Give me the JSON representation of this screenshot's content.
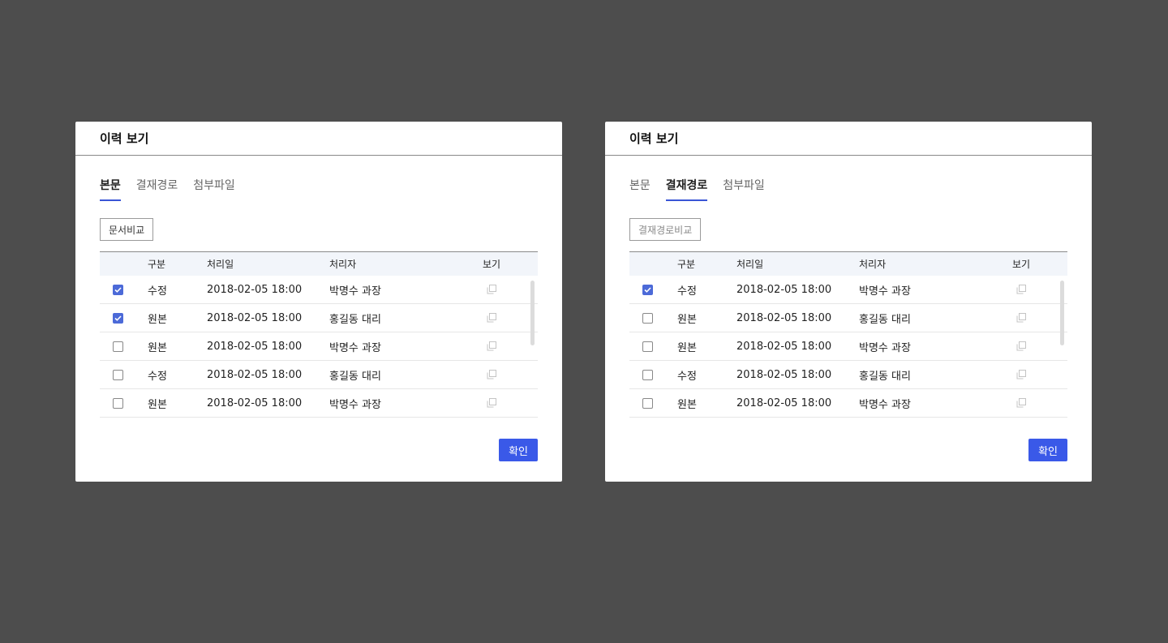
{
  "left": {
    "title": "이력 보기",
    "tabs": [
      "본문",
      "결재경로",
      "첨부파일"
    ],
    "active_tab": 0,
    "compare_label": "문서비교",
    "headers": {
      "type": "구분",
      "date": "처리일",
      "user": "처리자",
      "view": "보기"
    },
    "rows": [
      {
        "checked": true,
        "type": "수정",
        "date": "2018-02-05 18:00",
        "user": "박명수 과장"
      },
      {
        "checked": true,
        "type": "원본",
        "date": "2018-02-05 18:00",
        "user": "홍길동 대리"
      },
      {
        "checked": false,
        "type": "원본",
        "date": "2018-02-05 18:00",
        "user": "박명수 과장"
      },
      {
        "checked": false,
        "type": "수정",
        "date": "2018-02-05 18:00",
        "user": "홍길동 대리"
      },
      {
        "checked": false,
        "type": "원본",
        "date": "2018-02-05 18:00",
        "user": "박명수 과장"
      }
    ],
    "confirm_label": "확인"
  },
  "right": {
    "title": "이력 보기",
    "tabs": [
      "본문",
      "결재경로",
      "첨부파일"
    ],
    "active_tab": 1,
    "compare_label": "결재경로비교",
    "headers": {
      "type": "구분",
      "date": "처리일",
      "user": "처리자",
      "view": "보기"
    },
    "rows": [
      {
        "checked": true,
        "type": "수정",
        "date": "2018-02-05 18:00",
        "user": "박명수 과장"
      },
      {
        "checked": false,
        "type": "원본",
        "date": "2018-02-05 18:00",
        "user": "홍길동 대리"
      },
      {
        "checked": false,
        "type": "원본",
        "date": "2018-02-05 18:00",
        "user": "박명수 과장"
      },
      {
        "checked": false,
        "type": "수정",
        "date": "2018-02-05 18:00",
        "user": "홍길동 대리"
      },
      {
        "checked": false,
        "type": "원본",
        "date": "2018-02-05 18:00",
        "user": "박명수 과장"
      }
    ],
    "confirm_label": "확인"
  },
  "colors": {
    "accent": "#3a59e8",
    "checkbox": "#4c6ad8",
    "header_bg": "#f2f5fa",
    "backdrop": "#4d4d4d"
  },
  "icons": {
    "view": "copy-icon",
    "check": "check-icon"
  }
}
